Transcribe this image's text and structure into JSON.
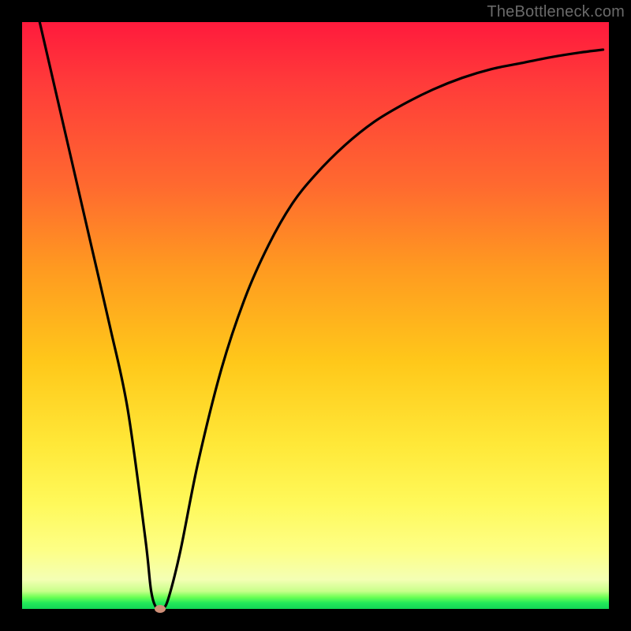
{
  "watermark": "TheBottleneck.com",
  "colors": {
    "frame": "#000000",
    "gradient_top": "#ff1a3c",
    "gradient_mid": "#ffcf20",
    "gradient_bottom": "#12d556",
    "curve": "#000000",
    "marker": "#cf8f78"
  },
  "chart_data": {
    "type": "line",
    "title": "",
    "xlabel": "",
    "ylabel": "",
    "xlim": [
      0,
      100
    ],
    "ylim": [
      0,
      100
    ],
    "grid": false,
    "legend": null,
    "series": [
      {
        "name": "bottleneck-curve",
        "x": [
          3,
          6,
          9,
          12,
          15,
          18,
          21,
          22,
          23,
          24,
          25,
          27,
          30,
          34,
          38,
          42,
          46,
          50,
          55,
          60,
          65,
          70,
          75,
          80,
          85,
          90,
          95,
          99
        ],
        "y": [
          100,
          87,
          74,
          61,
          48,
          34,
          12,
          3,
          0,
          0,
          2,
          10,
          25,
          41,
          53,
          62,
          69,
          74,
          79,
          83,
          86,
          88.5,
          90.5,
          92,
          93,
          94,
          94.8,
          95.3
        ]
      }
    ],
    "marker": {
      "x": 23.5,
      "y": 0,
      "label": "optimal-point"
    },
    "annotations": []
  }
}
